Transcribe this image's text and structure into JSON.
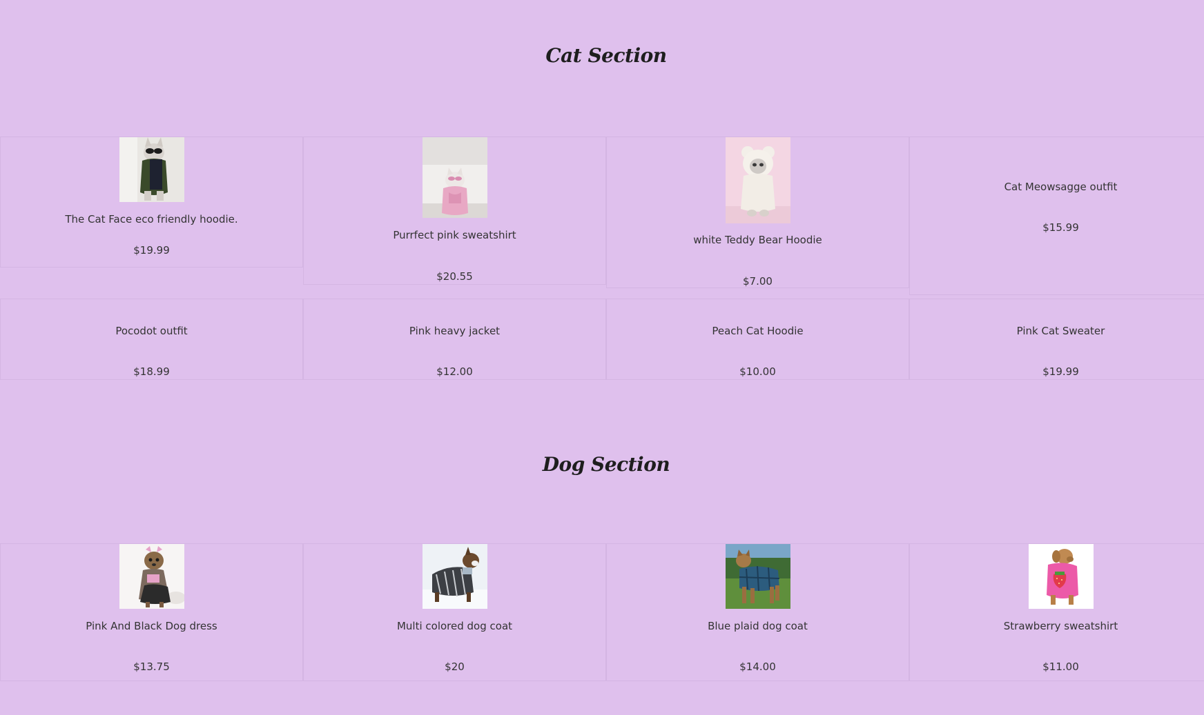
{
  "cat_section": {
    "title": "Cat Section",
    "items": [
      {
        "name": "The Cat Face eco friendly hoodie.",
        "price": "$19.99"
      },
      {
        "name": "Purrfect pink sweatshirt",
        "price": "$20.55"
      },
      {
        "name": "white Teddy Bear Hoodie",
        "price": "$7.00"
      },
      {
        "name": "Cat Meowsagge outfit",
        "price": "$15.99"
      },
      {
        "name": "Pocodot outfit",
        "price": "$18.99"
      },
      {
        "name": "Pink heavy jacket",
        "price": "$12.00"
      },
      {
        "name": "Peach Cat Hoodie",
        "price": "$10.00"
      },
      {
        "name": "Pink Cat Sweater",
        "price": "$19.99"
      }
    ]
  },
  "dog_section": {
    "title": "Dog Section",
    "items": [
      {
        "name": "Pink And Black Dog dress",
        "price": "$13.75"
      },
      {
        "name": "Multi colored dog coat",
        "price": "$20"
      },
      {
        "name": "Blue plaid dog coat",
        "price": "$14.00"
      },
      {
        "name": "Strawberry sweatshirt",
        "price": "$11.00"
      }
    ]
  }
}
